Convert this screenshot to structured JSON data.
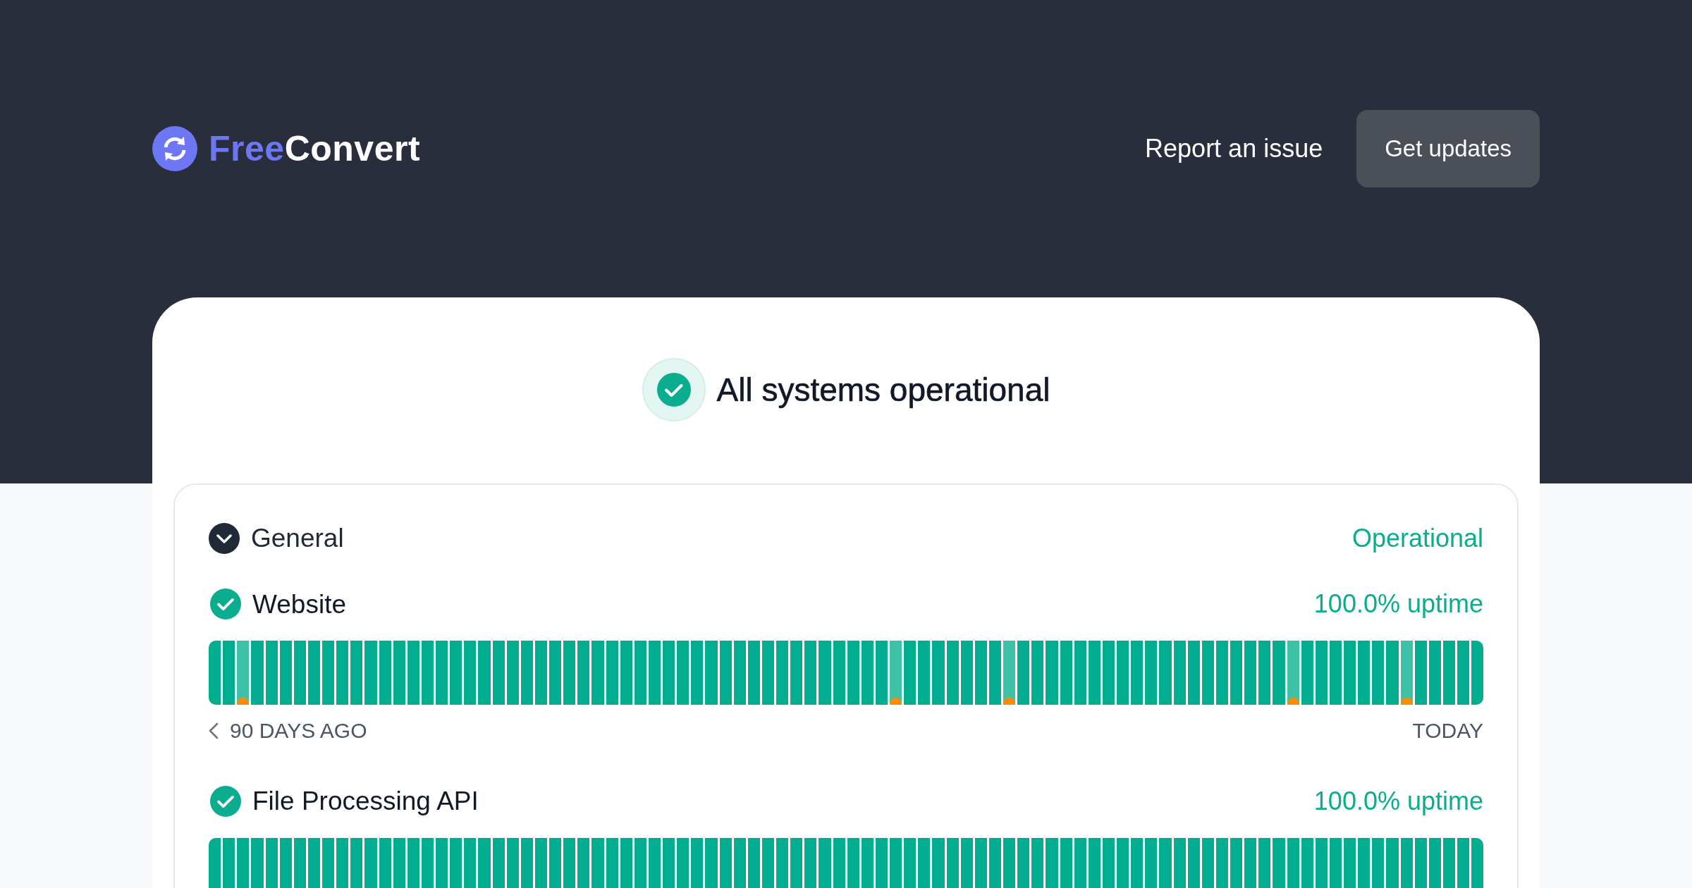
{
  "header": {
    "logo": {
      "text_1": "Free",
      "text_2": "Convert"
    },
    "report_link": "Report an issue",
    "updates_button": "Get updates"
  },
  "overall_status": {
    "text": "All systems operational"
  },
  "groups": [
    {
      "name": "General",
      "expanded": true,
      "status": "Operational",
      "services": [
        {
          "name": "Website",
          "uptime": "100.0% uptime",
          "range_start": "90 DAYS AGO",
          "range_end": "TODAY",
          "days": [
            {
              "incident": false
            },
            {
              "incident": false
            },
            {
              "incident": true
            },
            {
              "incident": false
            },
            {
              "incident": false
            },
            {
              "incident": false
            },
            {
              "incident": false
            },
            {
              "incident": false
            },
            {
              "incident": false
            },
            {
              "incident": false
            },
            {
              "incident": false
            },
            {
              "incident": false
            },
            {
              "incident": false
            },
            {
              "incident": false
            },
            {
              "incident": false
            },
            {
              "incident": false
            },
            {
              "incident": false
            },
            {
              "incident": false
            },
            {
              "incident": false
            },
            {
              "incident": false
            },
            {
              "incident": false
            },
            {
              "incident": false
            },
            {
              "incident": false
            },
            {
              "incident": false
            },
            {
              "incident": false
            },
            {
              "incident": false
            },
            {
              "incident": false
            },
            {
              "incident": false
            },
            {
              "incident": false
            },
            {
              "incident": false
            },
            {
              "incident": false
            },
            {
              "incident": false
            },
            {
              "incident": false
            },
            {
              "incident": false
            },
            {
              "incident": false
            },
            {
              "incident": false
            },
            {
              "incident": false
            },
            {
              "incident": false
            },
            {
              "incident": false
            },
            {
              "incident": false
            },
            {
              "incident": false
            },
            {
              "incident": false
            },
            {
              "incident": false
            },
            {
              "incident": false
            },
            {
              "incident": false
            },
            {
              "incident": false
            },
            {
              "incident": false
            },
            {
              "incident": false
            },
            {
              "incident": true
            },
            {
              "incident": false
            },
            {
              "incident": false
            },
            {
              "incident": false
            },
            {
              "incident": false
            },
            {
              "incident": false
            },
            {
              "incident": false
            },
            {
              "incident": false
            },
            {
              "incident": true
            },
            {
              "incident": false
            },
            {
              "incident": false
            },
            {
              "incident": false
            },
            {
              "incident": false
            },
            {
              "incident": false
            },
            {
              "incident": false
            },
            {
              "incident": false
            },
            {
              "incident": false
            },
            {
              "incident": false
            },
            {
              "incident": false
            },
            {
              "incident": false
            },
            {
              "incident": false
            },
            {
              "incident": false
            },
            {
              "incident": false
            },
            {
              "incident": false
            },
            {
              "incident": false
            },
            {
              "incident": false
            },
            {
              "incident": false
            },
            {
              "incident": false
            },
            {
              "incident": true
            },
            {
              "incident": false
            },
            {
              "incident": false
            },
            {
              "incident": false
            },
            {
              "incident": false
            },
            {
              "incident": false
            },
            {
              "incident": false
            },
            {
              "incident": false
            },
            {
              "incident": true
            },
            {
              "incident": false
            },
            {
              "incident": false
            },
            {
              "incident": false
            },
            {
              "incident": false
            },
            {
              "incident": false
            }
          ]
        },
        {
          "name": "File Processing API",
          "uptime": "100.0% uptime",
          "days": [
            {
              "incident": false
            },
            {
              "incident": false
            },
            {
              "incident": false
            },
            {
              "incident": false
            },
            {
              "incident": false
            },
            {
              "incident": false
            },
            {
              "incident": false
            },
            {
              "incident": false
            },
            {
              "incident": false
            },
            {
              "incident": false
            },
            {
              "incident": false
            },
            {
              "incident": false
            },
            {
              "incident": false
            },
            {
              "incident": false
            },
            {
              "incident": false
            },
            {
              "incident": false
            },
            {
              "incident": false
            },
            {
              "incident": false
            },
            {
              "incident": false
            },
            {
              "incident": false
            },
            {
              "incident": false
            },
            {
              "incident": false
            },
            {
              "incident": false
            },
            {
              "incident": false
            },
            {
              "incident": false
            },
            {
              "incident": false
            },
            {
              "incident": false
            },
            {
              "incident": false
            },
            {
              "incident": false
            },
            {
              "incident": false
            },
            {
              "incident": false
            },
            {
              "incident": false
            },
            {
              "incident": false
            },
            {
              "incident": false
            },
            {
              "incident": false
            },
            {
              "incident": false
            },
            {
              "incident": false
            },
            {
              "incident": false
            },
            {
              "incident": false
            },
            {
              "incident": false
            },
            {
              "incident": false
            },
            {
              "incident": false
            },
            {
              "incident": false
            },
            {
              "incident": false
            },
            {
              "incident": false
            },
            {
              "incident": false
            },
            {
              "incident": false
            },
            {
              "incident": false
            },
            {
              "incident": false
            },
            {
              "incident": false
            },
            {
              "incident": false
            },
            {
              "incident": false
            },
            {
              "incident": false
            },
            {
              "incident": false
            },
            {
              "incident": false
            },
            {
              "incident": false
            },
            {
              "incident": false
            },
            {
              "incident": false
            },
            {
              "incident": false
            },
            {
              "incident": false
            },
            {
              "incident": false
            },
            {
              "incident": false
            },
            {
              "incident": false
            },
            {
              "incident": false
            },
            {
              "incident": false
            },
            {
              "incident": false
            },
            {
              "incident": false
            },
            {
              "incident": false
            },
            {
              "incident": false
            },
            {
              "incident": false
            },
            {
              "incident": false
            },
            {
              "incident": false
            },
            {
              "incident": false
            },
            {
              "incident": false
            },
            {
              "incident": false
            },
            {
              "incident": false
            },
            {
              "incident": false
            },
            {
              "incident": false
            },
            {
              "incident": false
            },
            {
              "incident": false
            },
            {
              "incident": false
            },
            {
              "incident": false
            },
            {
              "incident": false
            },
            {
              "incident": false
            },
            {
              "incident": false
            },
            {
              "incident": false
            },
            {
              "incident": false
            },
            {
              "incident": false
            },
            {
              "incident": false
            },
            {
              "incident": false
            }
          ]
        }
      ]
    }
  ]
}
